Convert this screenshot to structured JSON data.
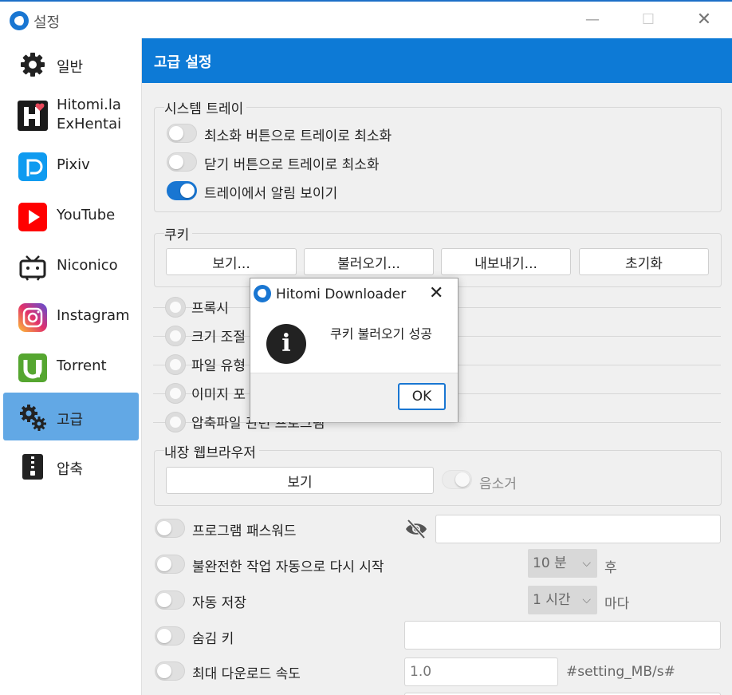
{
  "window": {
    "title": "설정",
    "minimize": "—",
    "maximize": "☐",
    "close": "✕"
  },
  "sidebar": {
    "items": [
      {
        "label": "일반",
        "icon": "gear-icon"
      },
      {
        "label": "Hitomi.la\nExHentai",
        "icon": "hitomi-icon"
      },
      {
        "label": "Pixiv",
        "icon": "pixiv-icon"
      },
      {
        "label": "YouTube",
        "icon": "youtube-icon"
      },
      {
        "label": "Niconico",
        "icon": "niconico-icon"
      },
      {
        "label": "Instagram",
        "icon": "instagram-icon"
      },
      {
        "label": "Torrent",
        "icon": "utorrent-icon"
      },
      {
        "label": "고급",
        "icon": "gears-icon"
      },
      {
        "label": "압축",
        "icon": "zip-icon"
      }
    ],
    "active_index": 7
  },
  "main": {
    "header": "고급 설정",
    "tray": {
      "title": "시스템 트레이",
      "options": [
        {
          "label": "최소화 버튼으로 트레이로 최소화",
          "on": false
        },
        {
          "label": "닫기 버튼으로 트레이로 최소화",
          "on": false
        },
        {
          "label": "트레이에서 알림 보이기",
          "on": true
        }
      ]
    },
    "cookie": {
      "title": "쿠키",
      "buttons": [
        "보기...",
        "불러오기...",
        "내보내기...",
        "초기화"
      ]
    },
    "radio_sections": [
      {
        "label": "프록시"
      },
      {
        "label": "크기 조절"
      },
      {
        "label": "파일 유형"
      },
      {
        "label": "이미지 포"
      },
      {
        "label": "압축파일 관련 프로그램"
      }
    ],
    "browser": {
      "title": "내장 웹브라우저",
      "view_button": "보기",
      "mute_label": "음소거"
    },
    "settings": [
      {
        "label": "프로그램 패스워드",
        "on": false
      },
      {
        "label": "불완전한 작업 자동으로 다시 시작",
        "on": false,
        "select": "10 분",
        "suffix": "후"
      },
      {
        "label": "자동 저장",
        "on": false,
        "select": "1 시간",
        "suffix": "마다"
      },
      {
        "label": "숨김 키",
        "on": false
      },
      {
        "label": "최대 다운로드 속도",
        "on": false,
        "input": "1.0",
        "suffix": "#setting_MB/s#"
      }
    ]
  },
  "dialog": {
    "title": "Hitomi Downloader",
    "message": "쿠키 불러오기 성공",
    "ok": "OK"
  },
  "colors": {
    "accent": "#0d7ad6",
    "sidebar_active": "#62a8e5",
    "toggle_on": "#1976d2"
  }
}
